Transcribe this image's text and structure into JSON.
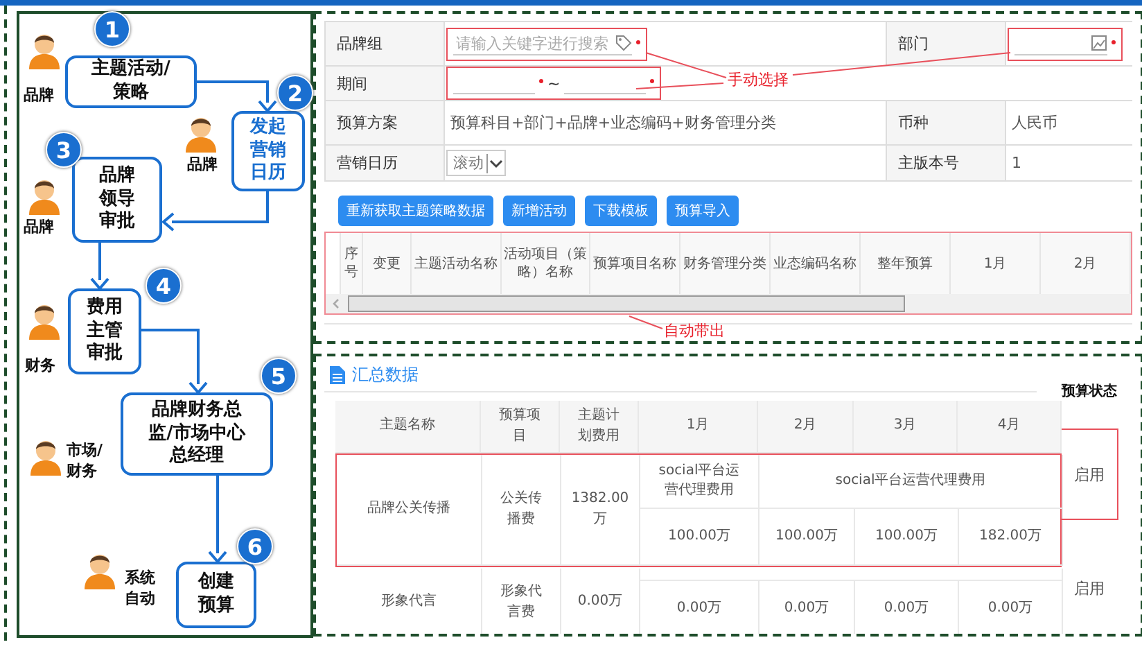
{
  "flow": {
    "steps": [
      {
        "number": "1",
        "text": "主题活动/策略",
        "role": "品牌",
        "highlighted": false
      },
      {
        "number": "2",
        "text": "发起营销日历",
        "role": "品牌",
        "highlighted": true
      },
      {
        "number": "3",
        "text": "品牌领导审批",
        "role": "品牌",
        "highlighted": false
      },
      {
        "number": "4",
        "text": "费用主管审批",
        "role": "财务",
        "highlighted": false
      },
      {
        "number": "5",
        "text": "品牌财务总监/市场中心总经理",
        "role": "市场/财务",
        "highlighted": false
      },
      {
        "number": "6",
        "text": "创建预算",
        "role": "系统自动",
        "highlighted": false
      }
    ]
  },
  "form": {
    "rows": [
      {
        "cells": [
          {
            "label": "品牌组",
            "kind": "search",
            "placeholder": "请输入关键字进行搜索",
            "required": true,
            "highlighted": true
          },
          {
            "label": "部门",
            "kind": "picker",
            "required": true,
            "highlighted": true
          }
        ]
      },
      {
        "cells": [
          {
            "label": "期间",
            "kind": "range",
            "separator": "~",
            "required": true,
            "highlighted": true
          }
        ]
      },
      {
        "cells": [
          {
            "label": "预算方案",
            "kind": "text",
            "value": "预算科目+部门+品牌+业态编码+财务管理分类"
          },
          {
            "label": "币种",
            "kind": "text",
            "value": "人民币"
          }
        ]
      },
      {
        "cells": [
          {
            "label": "营销日历",
            "kind": "select",
            "value": "滚动"
          },
          {
            "label": "主版本号",
            "kind": "text",
            "value": "1"
          }
        ]
      }
    ]
  },
  "annotations": [
    {
      "text": "手动选择"
    },
    {
      "text": "自动带出"
    }
  ],
  "toolbar": {
    "buttons": [
      "重新获取主题策略数据",
      "新增活动",
      "下载模板",
      "预算导入"
    ]
  },
  "grid": {
    "highlighted": true,
    "columns": [
      "序号",
      "变更",
      "主题活动名称",
      "活动项目（策略）名称",
      "预算项目名称",
      "财务管理分类",
      "业态编码名称",
      "整年预算",
      "1月",
      "2月"
    ]
  },
  "summary": {
    "title": "汇总数据",
    "status_heading": "预算状态",
    "columns": [
      "主题名称",
      "预算项目",
      "主题计划费用",
      "1月",
      "2月",
      "3月",
      "4月"
    ],
    "rows": [
      {
        "name": "品牌公关传播",
        "item": "公关传播费",
        "planned": "1382.00万",
        "notes": [
          {
            "text": "social平台运营代理费用"
          },
          {
            "text": "social平台运营代理费用"
          }
        ],
        "amounts": [
          "100.00万",
          "100.00万",
          "100.00万",
          "182.00万"
        ],
        "status": "启用",
        "highlighted": true
      },
      {
        "name": "形象代言",
        "item": "形象代言费",
        "planned": "0.00万",
        "amounts": [
          "0.00万",
          "0.00万",
          "0.00万",
          "0.00万"
        ],
        "status": "启用",
        "highlighted": false
      }
    ]
  }
}
